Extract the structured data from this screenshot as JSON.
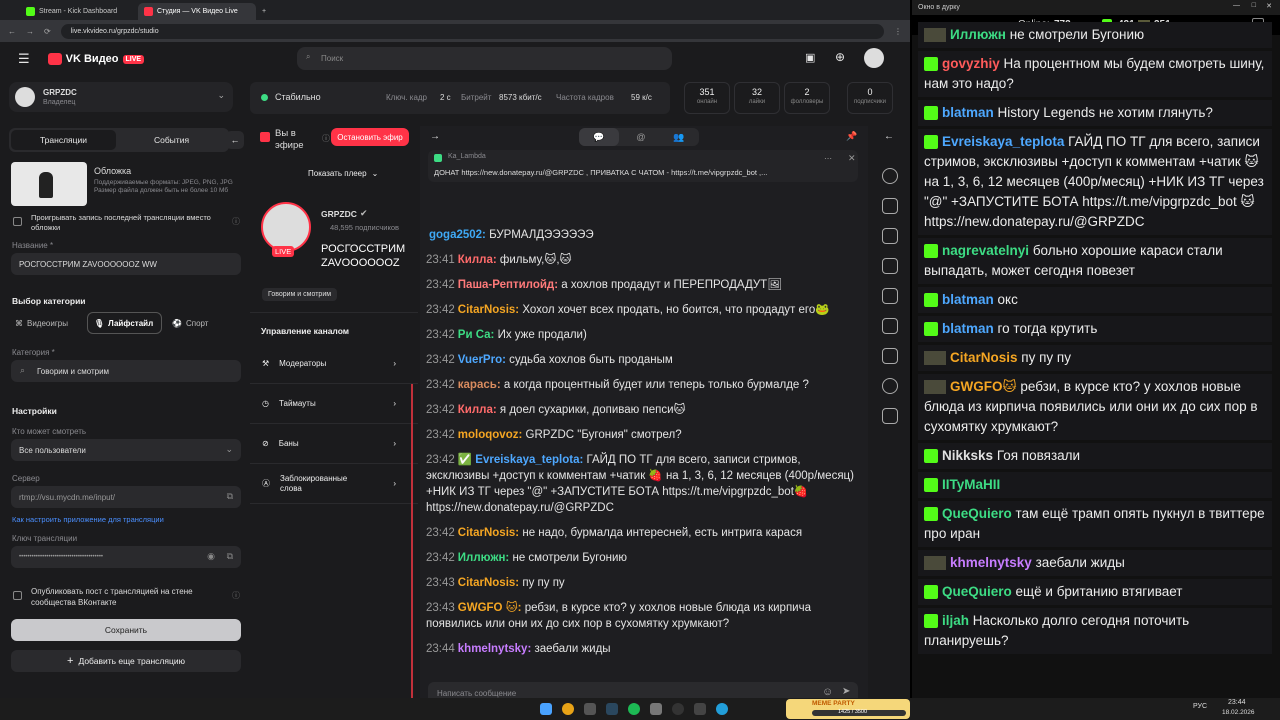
{
  "tabs": [
    {
      "label": "Stream - Kick Dashboard",
      "color": "#53fc18"
    },
    {
      "label": "Студия — VK Видео Live",
      "color": "#ff3347"
    }
  ],
  "url": "live.vkvideo.ru/grpzdc/studio",
  "header": {
    "logo": "VK Видео",
    "live": "LIVE",
    "search_placeholder": "Поиск"
  },
  "channel": {
    "name": "GRPZDC",
    "role": "Владелец"
  },
  "status": {
    "label": "Стабильно",
    "keyframe_label": "Ключ. кадр",
    "keyframe": "2 с",
    "bitrate_label": "Битрейт",
    "bitrate": "8573 кбит/с",
    "fps_label": "Частота кадров",
    "fps": "59 к/с"
  },
  "stats": [
    {
      "value": "351",
      "label": "онлайн"
    },
    {
      "value": "32",
      "label": "лайки"
    },
    {
      "value": "2",
      "label": "фолловеры"
    },
    {
      "value": "0",
      "label": "подписчики"
    }
  ],
  "left": {
    "tab_streams": "Трансляции",
    "tab_events": "События",
    "cover_title": "Обложка",
    "cover_hint": "Поддерживаемые форматы: JPEG, PNG, JPG Размер файла должен быть не более 10 Мб",
    "replay_label": "Проигрывать запись последней трансляции вместо обложки",
    "name_label": "Название *",
    "name_value": "РОСГОССТРИМ ZAVOOOOOOZ WW",
    "category_section": "Выбор категории",
    "cat_games": "Видеоигры",
    "cat_life": "Лайфстайл",
    "cat_sport": "Спорт",
    "category_label": "Категория *",
    "category_value": "Говорим и смотрим",
    "settings_section": "Настройки",
    "who_label": "Кто может смотреть",
    "who_value": "Все пользователи",
    "server_label": "Сервер",
    "server_value": "rtmp://vsu.mycdn.me/input/",
    "howto_link": "Как настроить приложение для трансляции",
    "key_label": "Ключ трансляции",
    "key_value": "••••••••••••••••••••••••••••••••••••••••",
    "publish_label": "Опубликовать пост с трансляцией на стене сообщества ВКонтакте",
    "save": "Сохранить",
    "add": "Добавить еще трансляцию"
  },
  "middle": {
    "on_air": "Вы в эфире",
    "stop": "Остановить эфир",
    "show_player": "Показать плеер",
    "ch_name": "GRPZDC",
    "subs": "48,595 подписчиков",
    "title": "РОСГОССТРИМ ZAVOOOOOOZ WW",
    "live": "LIVE",
    "cat_tag": "Говорим и смотрим",
    "manage": "Управление каналом",
    "menu": [
      "Модераторы",
      "Таймауты",
      "Баны",
      "Заблокированные слова"
    ]
  },
  "chat": {
    "pinned_user": "Ka_Lambda",
    "pinned_text": "ДОНАТ https://new.donatepay.ru/@GRPZDC , ПРИВАТКА С ЧАТОМ - https://t.me/vipgrpzdc_bot ,...",
    "input_placeholder": "Написать сообщение",
    "messages": [
      {
        "t": "",
        "u": "goga2502:",
        "c": "#3fa9f5",
        "m": "БУРМАЛДЭЭЭЭЭЭ"
      },
      {
        "t": "23:41",
        "u": "Килла:",
        "c": "#ff6b6b",
        "m": "фильму,🐱,🐱"
      },
      {
        "t": "23:42",
        "u": "Паша-Рептилойд:",
        "c": "#ff7a7a",
        "m": "а хохлов продадут и ПЕРЕПРОДАДУТ🖼"
      },
      {
        "t": "23:42",
        "u": "CitarNosis:",
        "c": "#f5a623",
        "m": "Хохол хочет всех продать, но боится, что продадут его🐸"
      },
      {
        "t": "23:42",
        "u": "Ри Са:",
        "c": "#3ddc84",
        "m": "Их уже продали)"
      },
      {
        "t": "23:42",
        "u": "VuerPro:",
        "c": "#4ea8ff",
        "m": "судьба хохлов быть проданым"
      },
      {
        "t": "23:42",
        "u": "карась:",
        "c": "#d98c5f",
        "m": "а когда процентный будет или теперь только бурмалде ?"
      },
      {
        "t": "23:42",
        "u": "Килла:",
        "c": "#ff6b6b",
        "m": "я доел сухарики, допиваю пепси🐱"
      },
      {
        "t": "23:42",
        "u": "moloqovoz:",
        "c": "#f5a623",
        "m": "GRPZDC \"Бугония\" смотрел?"
      },
      {
        "t": "23:42",
        "u": "✅ Evreiskaya_teplota:",
        "c": "#4ea8ff",
        "m": "ГАЙД ПО ТГ для всего, записи стримов, эксклюзивы +доступ к комментам +чатик 🍓 на 1, 3, 6, 12 месяцев (400р/месяц) +НИК ИЗ ТГ через \"@\" +ЗАПУСТИТЕ БОТА https://t.me/vipgrpzdc_bot🍓 https://new.donatepay.ru/@GRPZDC"
      },
      {
        "t": "23:42",
        "u": "CitarNosis:",
        "c": "#f5a623",
        "m": "не надо, бурмалда интересней, есть интрига карася"
      },
      {
        "t": "23:42",
        "u": "Иллюжн:",
        "c": "#3ddc84",
        "m": "не смотрели Бугонию"
      },
      {
        "t": "23:43",
        "u": "CitarNosis:",
        "c": "#f5a623",
        "m": "пу пу пу"
      },
      {
        "t": "23:43",
        "u": "GWGFO 🐱:",
        "c": "#f5a623",
        "m": "ребзи, в курсе кто? у хохлов новые блюда из кирпича появились или они их до сих пор в сухомятку хрумкают?"
      },
      {
        "t": "23:44",
        "u": "khmelnytsky:",
        "c": "#c77dff",
        "m": "заебали жиды"
      }
    ]
  },
  "popup": {
    "window_title": "Окно в дурку",
    "online_label": "Online:",
    "online": "772",
    "kick_count": "421",
    "vk_count": "351",
    "messages": [
      {
        "u": "Иллюжн",
        "c": "#3ddc84",
        "m": "не смотрели Бугонию",
        "b": "vk"
      },
      {
        "u": "govyzhiy",
        "c": "#ff5b5b",
        "m": "На процентном мы будем смотреть шину, нам это надо?",
        "b": "kick"
      },
      {
        "u": "blatman",
        "c": "#4ea8ff",
        "m": "History Legends не хотим глянуть?",
        "b": "kick"
      },
      {
        "u": "Evreiskaya_teplota",
        "c": "#4ea8ff",
        "m": "ГАЙД ПО ТГ для всего, записи стримов, эксклюзивы +доступ к комментам +чатик 🐱 на 1, 3, 6, 12 месяцев (400р/месяц) +НИК ИЗ ТГ через \"@\" +ЗАПУСТИТЕ БОТА https://t.me/vipgrpzdc_bot 🐱 https://new.donatepay.ru/@GRPZDC",
        "b": "kick"
      },
      {
        "u": "nagrevatelnyi",
        "c": "#3ddc84",
        "m": "больно хорошие караси стали выпадать, может сегодня повезет",
        "b": "kick"
      },
      {
        "u": "blatman",
        "c": "#4ea8ff",
        "m": "окс",
        "b": "kick"
      },
      {
        "u": "blatman",
        "c": "#4ea8ff",
        "m": "го тогда крутить",
        "b": "kick"
      },
      {
        "u": "CitarNosis",
        "c": "#f5a623",
        "m": "пу пу пу",
        "b": "vk"
      },
      {
        "u": "GWGFO🐱",
        "c": "#f5a623",
        "m": "ребзи, в курсе кто? у хохлов новые блюда из кирпича появились или они их до сих пор в сухомятку хрумкают?",
        "b": "vk"
      },
      {
        "u": "Nikksks",
        "c": "#e0e0e0",
        "m": "Гоя повязали",
        "b": "kick"
      },
      {
        "u": "IITyMaHII",
        "c": "#3ddc84",
        "m": "",
        "b": "kick"
      },
      {
        "u": "QueQuiero",
        "c": "#3ddc84",
        "m": "там ещё трамп опять пукнул в твиттере про иран",
        "b": "kick"
      },
      {
        "u": "khmelnytsky",
        "c": "#c77dff",
        "m": "заебали жиды",
        "b": "vk"
      },
      {
        "u": "QueQuiero",
        "c": "#3ddc84",
        "m": "ещё и британию втягивает",
        "b": "kick"
      },
      {
        "u": "iljah",
        "c": "#3ddc84",
        "m": "Насколько долго сегодня поточить планируешь?",
        "b": "kick"
      }
    ]
  },
  "taskbar": {
    "lang": "РУС",
    "time": "23:44",
    "date": "18.02.2026",
    "widget": "MEME PARTY",
    "widget_sub": "1425 / 3500"
  }
}
